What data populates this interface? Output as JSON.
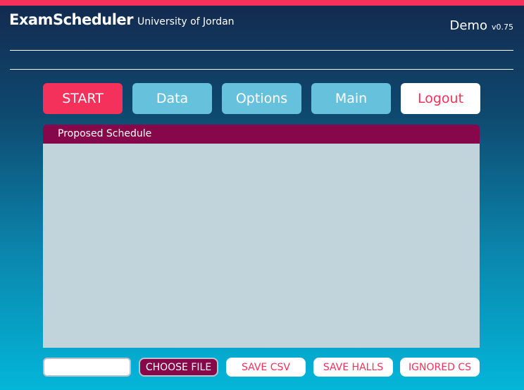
{
  "header": {
    "app_name": "ExamScheduler",
    "institution": "University of Jordan",
    "demo_label": "Demo",
    "version": "v0.75"
  },
  "nav": {
    "start": "START",
    "data": "Data",
    "options": "Options",
    "main": "Main",
    "logout": "Logout"
  },
  "panel": {
    "title": "Proposed Schedule"
  },
  "footer": {
    "file_value": "",
    "choose_file": "CHOOSE FILE",
    "save_csv": "SAVE CSV",
    "save_halls": "SAVE HALLS",
    "ignored_cs": "IGNORED CS"
  },
  "colors": {
    "accent": "#f4315a",
    "nav_button": "#66c1dc",
    "panel_header": "#87084a",
    "panel_body": "#c1d3db"
  }
}
